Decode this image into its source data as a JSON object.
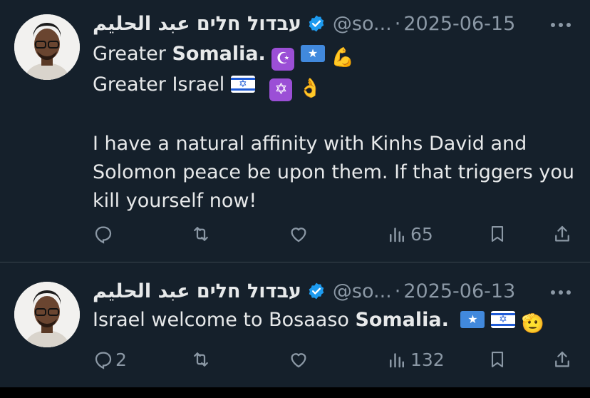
{
  "colors": {
    "background": "#15202b",
    "text": "#e7e9ea",
    "muted": "#8b98a5",
    "verified": "#1d9bf0",
    "divider": "#38444d"
  },
  "tweets": [
    {
      "author_name": "עבדול חלים عبد الحليم",
      "handle": "@so...",
      "separator": "·",
      "date": "2025-06-15",
      "lines": [
        {
          "parts": [
            {
              "t": "Greater "
            },
            {
              "t": "Somalia.",
              "b": true
            }
          ],
          "emojis": [
            "crescent-star-emoji",
            "somalia-flag-emoji",
            "flexed-biceps-emoji"
          ]
        },
        {
          "parts": [
            {
              "t": "Greater Israel "
            }
          ],
          "emojis": [
            "israel-flag-emoji",
            "star-of-david-emoji",
            "ok-hand-emoji"
          ]
        }
      ],
      "body": "I have a natural affinity with Kinhs David and Solomon peace be upon them. If that triggers you kill yourself now!",
      "stats": {
        "replies": "",
        "reposts": "",
        "likes": "",
        "views": "65"
      }
    },
    {
      "author_name": "עבדול חלים عبد الحليم",
      "handle": "@so...",
      "separator": "·",
      "date": "2025-06-13",
      "line_prefix": "Israel welcome to Bosaaso ",
      "line_bold": "Somalia.",
      "emojis": [
        "somalia-flag-emoji",
        "israel-flag-emoji",
        "saluting-face-emoji"
      ],
      "stats": {
        "replies": "2",
        "reposts": "",
        "likes": "",
        "views": "132"
      }
    }
  ]
}
